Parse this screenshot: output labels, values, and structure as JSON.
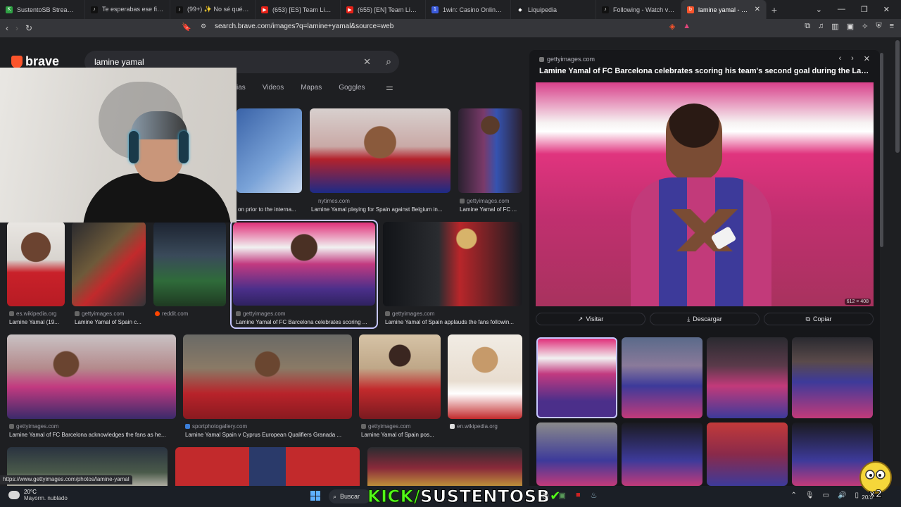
{
  "tabs": [
    {
      "title": "SustentoSB Stream - K",
      "color": "#2ea043",
      "glyph": "K"
    },
    {
      "title": "Te esperabas ese final? 🤔",
      "color": "#111111",
      "glyph": "♪"
    },
    {
      "title": "(99+) ✨ No sé qué tiene",
      "color": "#111111",
      "glyph": "♪"
    },
    {
      "title": "(653) [ES] Team Liquid",
      "color": "#e62117",
      "glyph": "▶"
    },
    {
      "title": "(655) [EN] Team Liquid",
      "color": "#e62117",
      "glyph": "▶"
    },
    {
      "title": "1win: Casino Online y Ap",
      "color": "#3b5bdb",
      "glyph": "1"
    },
    {
      "title": "Liquipedia",
      "color": "#1e1f22",
      "glyph": "◆"
    },
    {
      "title": "Following - Watch videos",
      "color": "#111111",
      "glyph": "♪"
    },
    {
      "title": "lamine yamal - Brave",
      "color": "#fb542b",
      "glyph": "b",
      "active": true
    }
  ],
  "toolbar": {
    "url": "search.brave.com/images?q=lamine+yamal&source=web"
  },
  "brand": {
    "name": "brave"
  },
  "search": {
    "value": "lamine yamal"
  },
  "navtabs": [
    "ias",
    "Videos",
    "Mapas",
    "Goggles"
  ],
  "results": {
    "row1": [
      {
        "source": "",
        "caption": "on prior to the interna..."
      },
      {
        "source": "nytimes.com",
        "caption": "Lamine Yamal playing for Spain against Belgium in..."
      },
      {
        "source": "gettyimages.com",
        "caption": "Lamine Yamal of FC ..."
      }
    ],
    "row2": [
      {
        "source": "es.wikipedia.org",
        "caption": "Lamine Yamal (19..."
      },
      {
        "source": "gettyimages.com",
        "caption": "Lamine Yamal of Spain c..."
      },
      {
        "source": "reddit.com",
        "caption": ""
      },
      {
        "source": "gettyimages.com",
        "caption": "Lamine Yamal of FC Barcelona celebrates scoring ..."
      },
      {
        "source": "gettyimages.com",
        "caption": "Lamine Yamal of Spain applauds the fans followin..."
      }
    ],
    "row3": [
      {
        "source": "gettyimages.com",
        "caption": "Lamine Yamal of FC Barcelona acknowledges the fans as he..."
      },
      {
        "source": "sportphotogallery.com",
        "caption": "Lamine Yamal Spain v Cyprus European Qualifiers Granada ..."
      },
      {
        "source": "gettyimages.com",
        "caption": "Lamine Yamal of Spain pos..."
      },
      {
        "source": "en.wikipedia.org",
        "caption": ""
      }
    ]
  },
  "panel": {
    "source": "gettyimages.com",
    "title": "Lamine Yamal of FC Barcelona celebrates scoring his team's second goal during the LaLi...",
    "dims": "612 × 408",
    "visit": "Visitar",
    "download": "Descargar",
    "copy": "Copiar"
  },
  "status_url": "https://www.gettyimages.com/photos/lamine-yamal",
  "taskbar": {
    "temp": "20°C",
    "weather": "Mayorm. nublado",
    "search": "Buscar",
    "overlay_green": "KICK/",
    "overlay_white": "SUSTENTOSB",
    "date": "20/0"
  }
}
